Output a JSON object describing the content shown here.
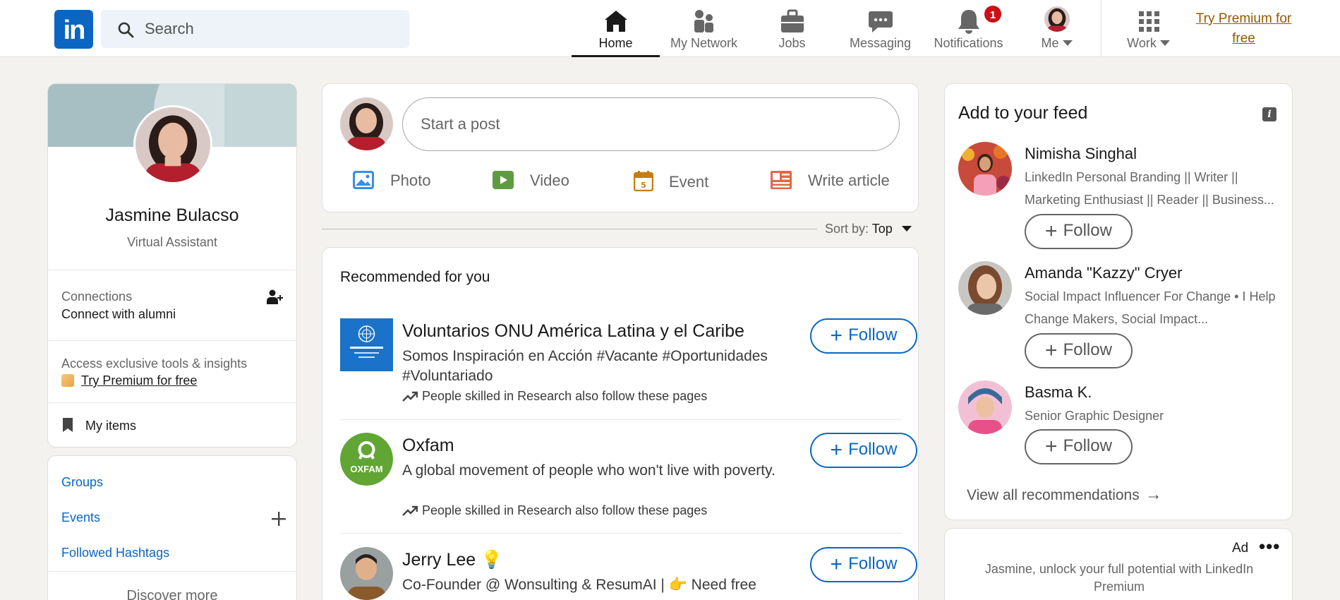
{
  "nav": {
    "search_placeholder": "Search",
    "items": [
      {
        "label": "Home",
        "active": true
      },
      {
        "label": "My Network"
      },
      {
        "label": "Jobs"
      },
      {
        "label": "Messaging"
      },
      {
        "label": "Notifications",
        "badge": "1"
      },
      {
        "label": "Me"
      },
      {
        "label": "Work"
      }
    ],
    "premium_line1": "Try Premium for",
    "premium_line2": "free",
    "logo_text": "in"
  },
  "profile": {
    "name": "Jasmine Bulacso",
    "title": "Virtual Assistant",
    "connections_label": "Connections",
    "connections_sub": "Connect with alumni",
    "premium_label": "Access exclusive tools & insights",
    "premium_try": "Try Premium for free",
    "my_items": "My items"
  },
  "groups": {
    "groups": "Groups",
    "events": "Events",
    "hashtags": "Followed Hashtags",
    "discover": "Discover more"
  },
  "post": {
    "start_post": "Start a post",
    "photo": "Photo",
    "video": "Video",
    "event": "Event",
    "article": "Write article"
  },
  "sort": {
    "label": "Sort by:",
    "value": "Top"
  },
  "recommended": {
    "title": "Recommended for you",
    "follow": "Follow",
    "items": [
      {
        "name": "Voluntarios ONU América Latina y el Caribe",
        "desc": "Somos Inspiración en Acción #Vacante #Oportunidades #Voluntariado",
        "note": "People skilled in Research also follow these pages"
      },
      {
        "name": "Oxfam",
        "desc": "A global movement of people who won't live with poverty.",
        "note": "People skilled in Research also follow these pages",
        "logo_text": "OXFAM"
      },
      {
        "name": "Jerry Lee 💡",
        "desc": "Co-Founder @ Wonsulting & ResumAI | 👉 Need free"
      }
    ]
  },
  "feed": {
    "title": "Add to your feed",
    "follow": "Follow",
    "people": [
      {
        "name": "Nimisha Singhal",
        "desc": "LinkedIn Personal Branding || Writer || Marketing Enthusiast || Reader || Business..."
      },
      {
        "name": "Amanda \"Kazzy\" Cryer",
        "desc": "Social Impact Influencer For Change • I Help Change Makers, Social Impact..."
      },
      {
        "name": "Basma K.",
        "desc": "Senior Graphic Designer"
      }
    ],
    "view_all": "View all recommendations"
  },
  "ad": {
    "label": "Ad",
    "text": "Jasmine, unlock your full potential with LinkedIn Premium"
  },
  "colors": {
    "brand": "#0a66c2",
    "premium": "#915907",
    "badge": "#cc1016"
  }
}
